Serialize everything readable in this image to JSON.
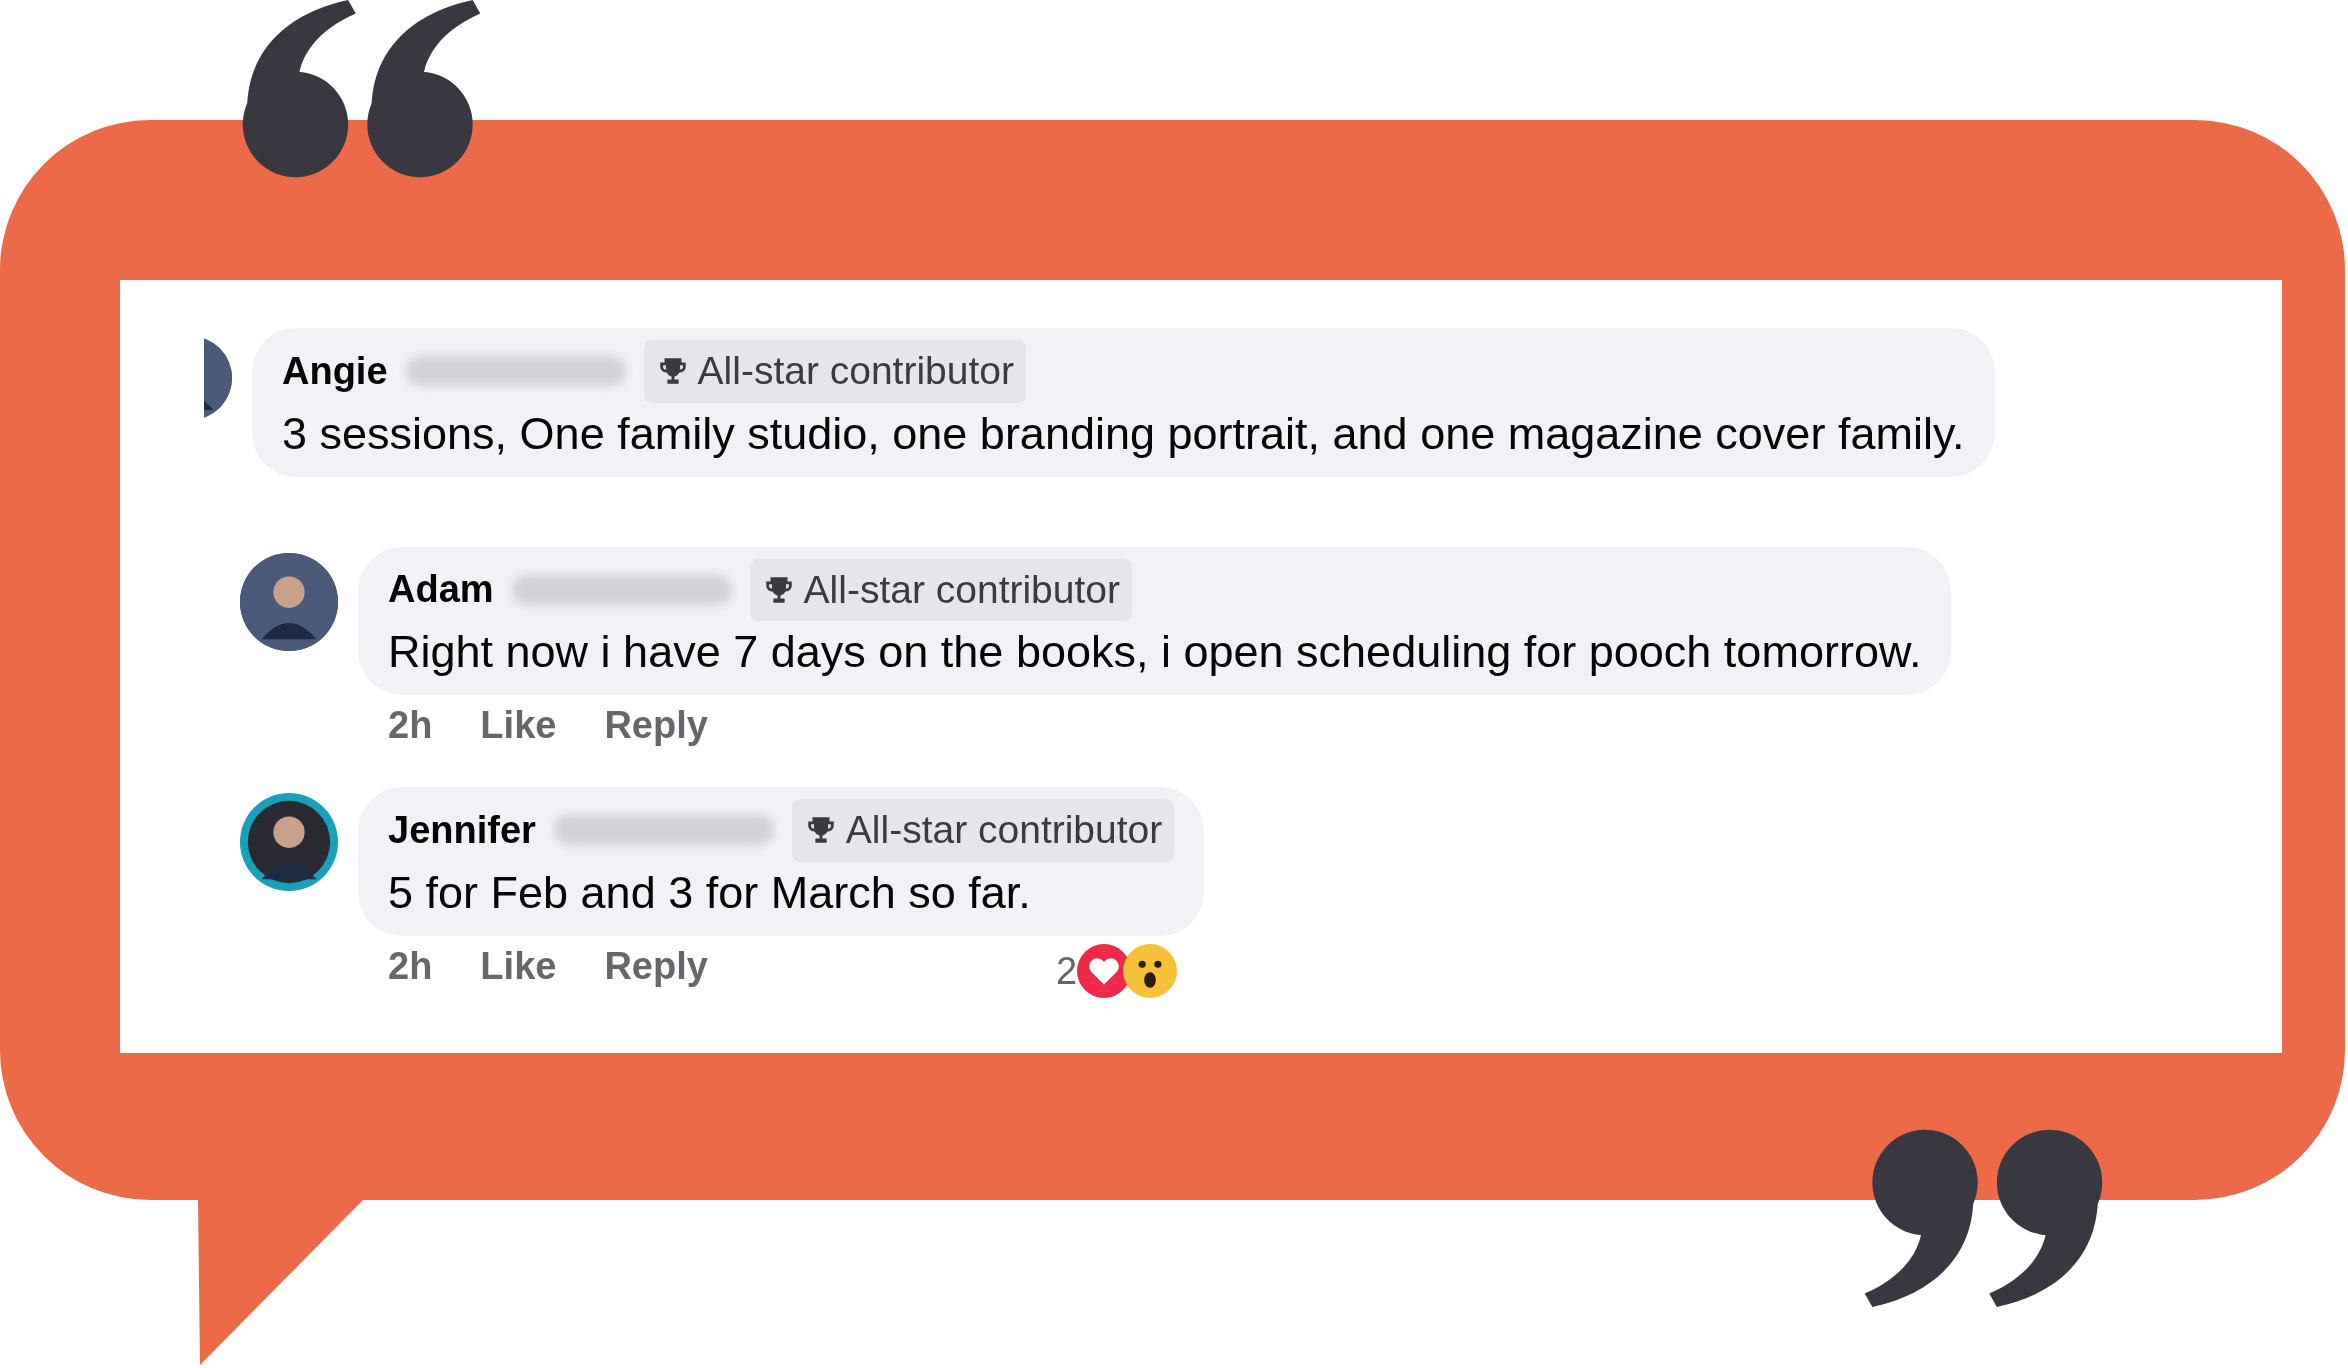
{
  "comments": [
    {
      "name": "Angie",
      "badge": "All-star contributor",
      "text": "3 sessions, One family studio, one branding portrait, and one magazine cover family.",
      "ring": false
    },
    {
      "name": "Adam",
      "badge": "All-star contributor",
      "text": "Right now i have 7 days on the books, i open scheduling for pooch tomorrow.",
      "time": "2h",
      "like": "Like",
      "reply": "Reply",
      "ring": false
    },
    {
      "name": "Jennifer",
      "badge": "All-star contributor",
      "text": "5 for Feb and 3 for March so far.",
      "time": "2h",
      "like": "Like",
      "reply": "Reply",
      "ring": true,
      "reactions": "2"
    }
  ]
}
